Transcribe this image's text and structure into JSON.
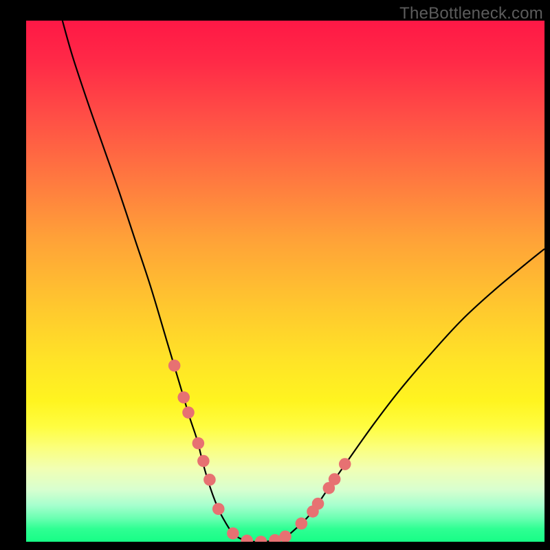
{
  "watermark": "TheBottleneck.com",
  "colors": {
    "dot": "#e77172",
    "dot_stroke": "#c95a5c",
    "curve": "#000000"
  },
  "chart_data": {
    "type": "line",
    "title": "",
    "xlabel": "",
    "ylabel": "",
    "xlim": [
      0,
      100
    ],
    "ylim": [
      0,
      100
    ],
    "grid": false,
    "series": [
      {
        "name": "curve",
        "x": [
          7,
          9,
          12,
          15,
          18,
          21,
          24,
          27,
          28.5,
          30,
          31.5,
          33,
          34,
          35,
          36,
          37,
          38,
          40,
          42.5,
          45,
          47.5,
          50,
          52,
          55,
          58,
          62,
          67,
          72,
          78,
          84,
          90,
          96,
          100
        ],
        "values": [
          100,
          93,
          84,
          75.5,
          67,
          58,
          49,
          39,
          34,
          29,
          24,
          19.5,
          15.5,
          12,
          9,
          6.5,
          4.5,
          1.5,
          0.2,
          0,
          0.2,
          1,
          2.5,
          5.5,
          9.8,
          15.5,
          22.5,
          29,
          36,
          42.5,
          48,
          53,
          56.2
        ]
      }
    ],
    "markers": {
      "name": "dots",
      "x": [
        28.6,
        30.4,
        31.3,
        33.2,
        34.2,
        35.4,
        37.1,
        39.9,
        42.6,
        45.3,
        48.0,
        50.0,
        53.1,
        55.3,
        56.3,
        58.4,
        59.5,
        61.5
      ],
      "values": [
        33.8,
        27.7,
        24.8,
        18.9,
        15.5,
        11.9,
        6.3,
        1.6,
        0.2,
        0,
        0.3,
        1,
        3.5,
        5.8,
        7.3,
        10.3,
        12,
        14.9
      ]
    }
  }
}
